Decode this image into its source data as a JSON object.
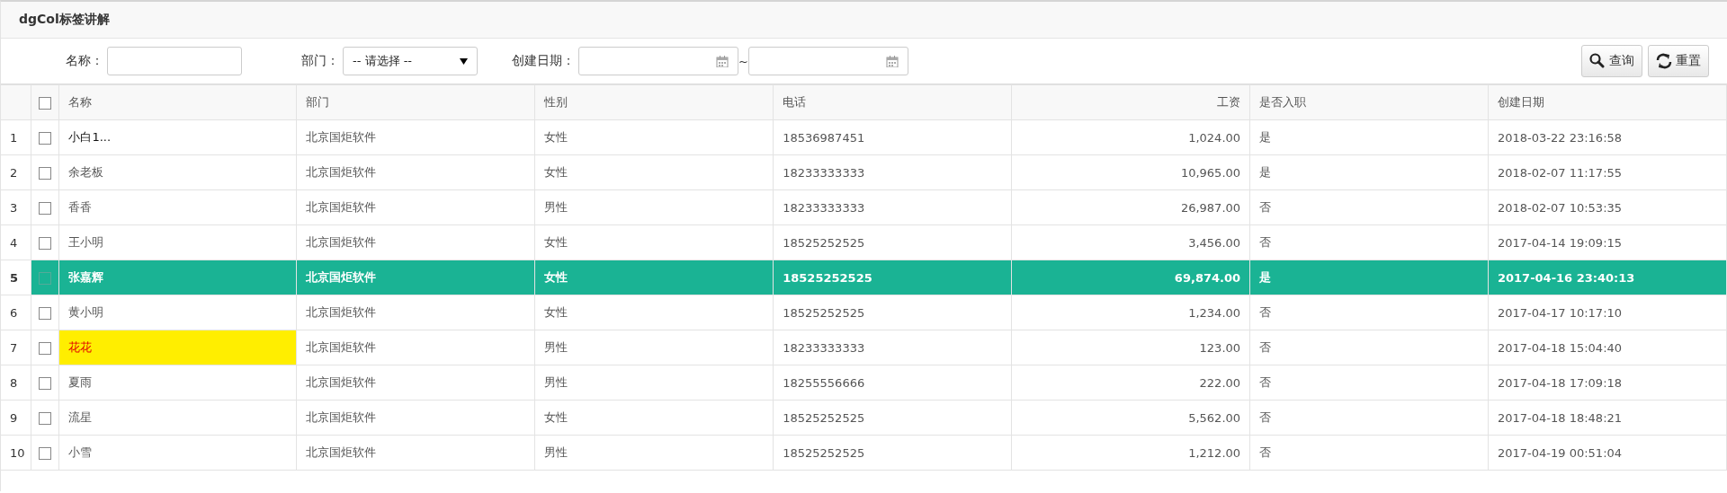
{
  "panel": {
    "title": "dgCol标签讲解"
  },
  "filters": [
    {
      "kind": "text",
      "label": "名称："
    },
    {
      "kind": "select",
      "label": "部门：",
      "value": "-- 请选择 --"
    },
    {
      "kind": "daterange",
      "label": "创建日期：",
      "separator": "~"
    }
  ],
  "buttons": [
    {
      "kind": "search",
      "label": "查询"
    },
    {
      "kind": "refresh",
      "label": "重置"
    }
  ],
  "table": {
    "select_all": {
      "checked": false
    },
    "columns": [
      "名称",
      "部门",
      "性别",
      "电话",
      "工资",
      "是否入职",
      "创建日期"
    ],
    "rows": [
      {
        "index": "1",
        "selected": false,
        "checked": false,
        "name_dark": true,
        "name_highlighted": false,
        "cells": [
          "小白1...",
          "北京国炬软件",
          "女性",
          "18536987451",
          "1,024.00",
          "是",
          "2018-03-22 23:16:58"
        ]
      },
      {
        "index": "2",
        "selected": false,
        "checked": false,
        "name_dark": false,
        "name_highlighted": false,
        "cells": [
          "余老板",
          "北京国炬软件",
          "女性",
          "18233333333",
          "10,965.00",
          "是",
          "2018-02-07 11:17:55"
        ]
      },
      {
        "index": "3",
        "selected": false,
        "checked": false,
        "name_dark": false,
        "name_highlighted": false,
        "cells": [
          "香香",
          "北京国炬软件",
          "男性",
          "18233333333",
          "26,987.00",
          "否",
          "2018-02-07 10:53:35"
        ]
      },
      {
        "index": "4",
        "selected": false,
        "checked": false,
        "name_dark": false,
        "name_highlighted": false,
        "cells": [
          "王小明",
          "北京国炬软件",
          "女性",
          "18525252525",
          "3,456.00",
          "否",
          "2017-04-14 19:09:15"
        ]
      },
      {
        "index": "5",
        "selected": true,
        "checked": false,
        "name_dark": false,
        "name_highlighted": false,
        "cells": [
          "张嘉辉",
          "北京国炬软件",
          "女性",
          "18525252525",
          "69,874.00",
          "是",
          "2017-04-16 23:40:13"
        ]
      },
      {
        "index": "6",
        "selected": false,
        "checked": false,
        "name_dark": false,
        "name_highlighted": false,
        "cells": [
          "黄小明",
          "北京国炬软件",
          "女性",
          "18525252525",
          "1,234.00",
          "否",
          "2017-04-17 10:17:10"
        ]
      },
      {
        "index": "7",
        "selected": false,
        "checked": false,
        "name_dark": false,
        "name_highlighted": true,
        "cells": [
          "花花",
          "北京国炬软件",
          "男性",
          "18233333333",
          "123.00",
          "否",
          "2017-04-18 15:04:40"
        ]
      },
      {
        "index": "8",
        "selected": false,
        "checked": false,
        "name_dark": false,
        "name_highlighted": false,
        "cells": [
          "夏雨",
          "北京国炬软件",
          "男性",
          "18255556666",
          "222.00",
          "否",
          "2017-04-18 17:09:18"
        ]
      },
      {
        "index": "9",
        "selected": false,
        "checked": false,
        "name_dark": false,
        "name_highlighted": false,
        "cells": [
          "流星",
          "北京国炬软件",
          "女性",
          "18525252525",
          "5,562.00",
          "否",
          "2017-04-18 18:48:21"
        ]
      },
      {
        "index": "10",
        "selected": false,
        "checked": false,
        "name_dark": false,
        "name_highlighted": false,
        "cells": [
          "小雪",
          "北京国炬软件",
          "男性",
          "18525252525",
          "1,212.00",
          "否",
          "2017-04-19 00:51:04"
        ]
      }
    ]
  }
}
